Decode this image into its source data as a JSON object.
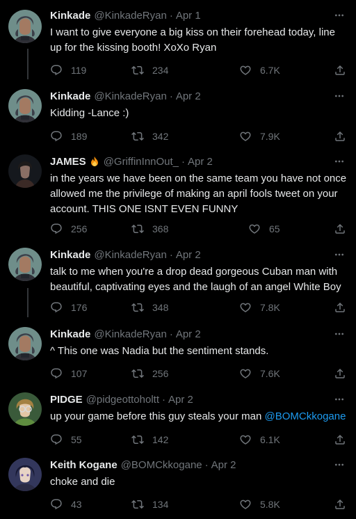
{
  "tweets": [
    {
      "name": "Kinkade",
      "handle": "@KinkadeRyan",
      "date": "Apr 1",
      "text": "I want to give everyone a big kiss on their forehead today, line up for the kissing booth! XoXo Ryan",
      "replies": "119",
      "retweets": "234",
      "likes": "6.7K"
    },
    {
      "name": "Kinkade",
      "handle": "@KinkadeRyan",
      "date": "Apr 2",
      "text": "Kidding -Lance :)",
      "replies": "189",
      "retweets": "342",
      "likes": "7.9K"
    },
    {
      "name": "JAMES",
      "handle": "@GriffinInnOut_",
      "date": "Apr 2",
      "text": "in the years we have been on the same team you have not once allowed me the privilege of making an april fools tweet on your account. THIS ONE ISNT EVEN FUNNY",
      "replies": "256",
      "retweets": "368",
      "likes": "65"
    },
    {
      "name": "Kinkade",
      "handle": "@KinkadeRyan",
      "date": "Apr 2",
      "text": "talk to me when you're a drop dead gorgeous Cuban man with beautiful, captivating eyes and the laugh of an angel White Boy",
      "replies": "176",
      "retweets": "348",
      "likes": "7.8K"
    },
    {
      "name": "Kinkade",
      "handle": "@KinkadeRyan",
      "date": "Apr 2",
      "text": "^ This one was Nadia but the sentiment stands.",
      "replies": "107",
      "retweets": "256",
      "likes": "7.6K"
    },
    {
      "name": "PIDGE",
      "handle": "@pidgeottoholtt",
      "date": "Apr 2",
      "text": "up your game before this guy steals your man ",
      "mention": "@BOMCkkogane",
      "replies": "55",
      "retweets": "142",
      "likes": "6.1K"
    },
    {
      "name": "Keith Kogane",
      "handle": "@BOMCkkogane",
      "date": "Apr 2",
      "text": "choke and die",
      "replies": "43",
      "retweets": "134",
      "likes": "5.8K"
    }
  ],
  "separator": "·",
  "colors": {
    "background": "#000000",
    "text": "#e7e9ea",
    "muted": "#71767b",
    "link": "#1d9bf0"
  },
  "icons": [
    "reply-icon",
    "retweet-icon",
    "like-icon",
    "share-icon",
    "more-icon",
    "fire-emoji"
  ]
}
